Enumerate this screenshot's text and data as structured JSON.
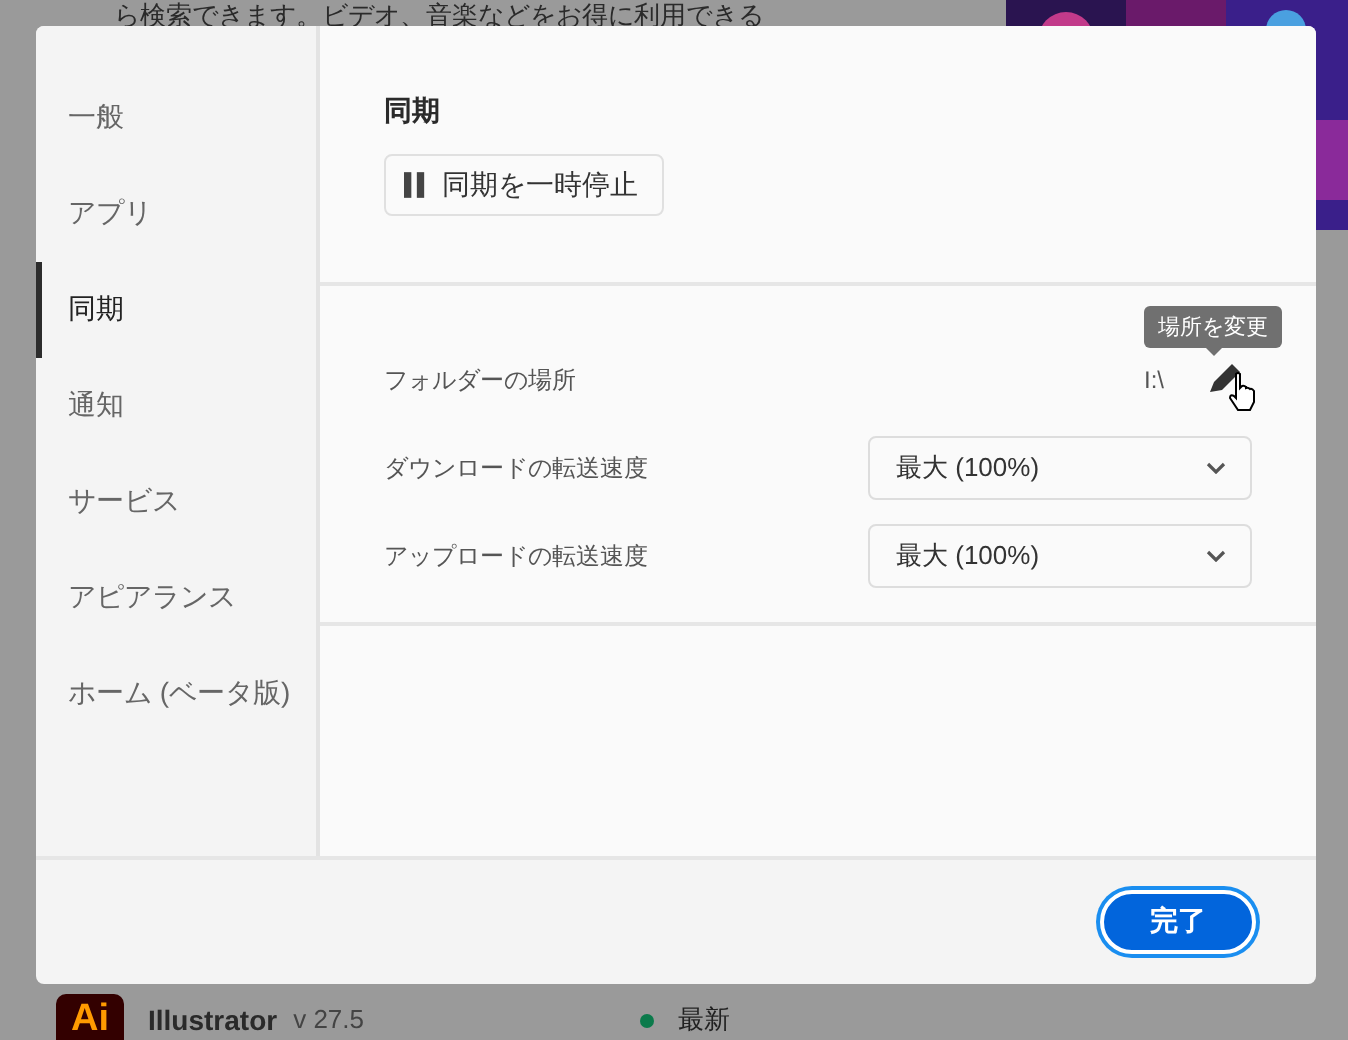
{
  "background": {
    "promo_text": "ら検索できます。ビデオ、音楽などをお得に利用できる",
    "app_row": {
      "icon_text": "Ai",
      "name": "Illustrator",
      "version": "v 27.5",
      "status": "最新"
    }
  },
  "sidebar": {
    "items": [
      {
        "label": "一般",
        "selected": false
      },
      {
        "label": "アプリ",
        "selected": false
      },
      {
        "label": "同期",
        "selected": true
      },
      {
        "label": "通知",
        "selected": false
      },
      {
        "label": "サービス",
        "selected": false
      },
      {
        "label": "アピアランス",
        "selected": false
      },
      {
        "label": "ホーム (ベータ版)",
        "selected": false
      }
    ]
  },
  "sync": {
    "title": "同期",
    "pause_button": "同期を一時停止"
  },
  "settings": [
    {
      "kind": "path",
      "label": "フォルダーの場所",
      "value": "I:\\",
      "tooltip": "場所を変更"
    },
    {
      "kind": "dropdown",
      "label": "ダウンロードの転送速度",
      "value": "最大 (100%)"
    },
    {
      "kind": "dropdown",
      "label": "アップロードの転送速度",
      "value": "最大 (100%)"
    }
  ],
  "done_button": "完了"
}
